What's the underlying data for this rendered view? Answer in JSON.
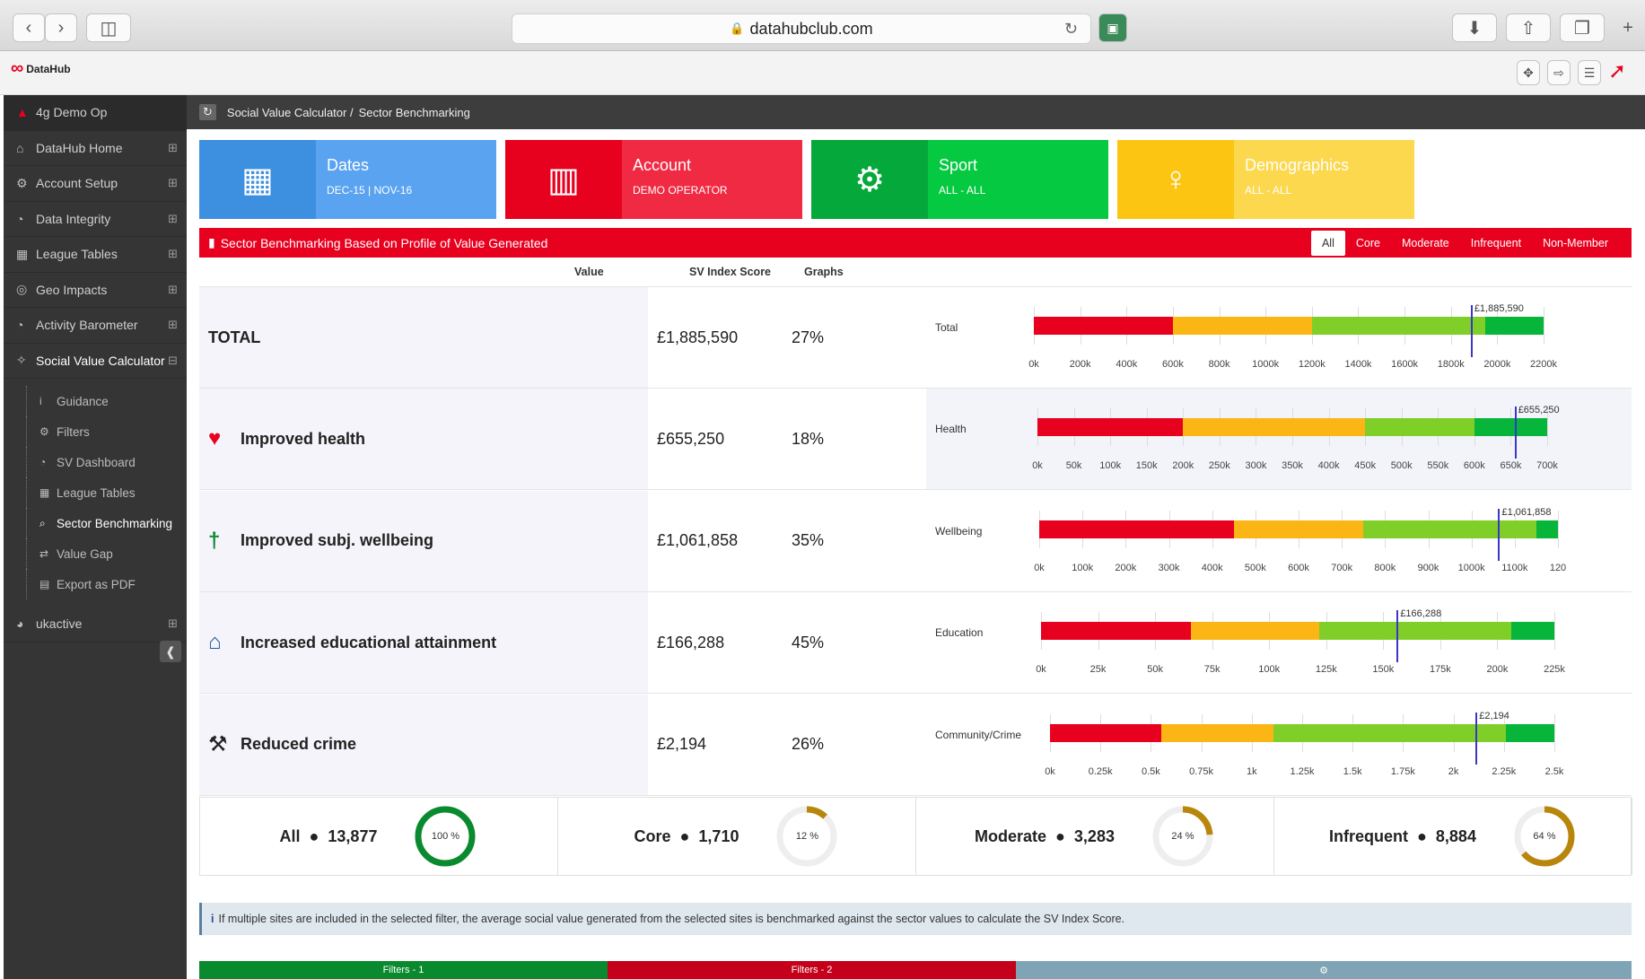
{
  "browser": {
    "url": "datahubclub.com"
  },
  "app": {
    "logo": "DataHub"
  },
  "sidebar": {
    "org": "4g Demo Op",
    "items": [
      {
        "label": "DataHub Home",
        "icon": "home-icon"
      },
      {
        "label": "Account Setup",
        "icon": "cogs-icon"
      },
      {
        "label": "Data Integrity",
        "icon": "dashboard-icon"
      },
      {
        "label": "League Tables",
        "icon": "table-icon"
      },
      {
        "label": "Geo Impacts",
        "icon": "globe-icon"
      },
      {
        "label": "Activity Barometer",
        "icon": "dashboard-icon"
      },
      {
        "label": "Social Value Calculator",
        "icon": "wand-icon"
      }
    ],
    "sub": [
      {
        "label": "Guidance",
        "icon": "info-icon"
      },
      {
        "label": "Filters",
        "icon": "cogs-icon"
      },
      {
        "label": "SV Dashboard",
        "icon": "dashboard-icon"
      },
      {
        "label": "League Tables",
        "icon": "table-icon"
      },
      {
        "label": "Sector Benchmarking",
        "icon": "search-icon"
      },
      {
        "label": "Value Gap",
        "icon": "exchange-icon"
      },
      {
        "label": "Export as PDF",
        "icon": "pdf-icon"
      }
    ],
    "extra": "ukactive"
  },
  "breadcrumb": {
    "a": "Social Value Calculator /",
    "b": "Sector Benchmarking"
  },
  "tiles": [
    {
      "title": "Dates",
      "sub": "DEC-15 | NOV-16",
      "color": "#3d8fe0",
      "light": "#5aa3f0"
    },
    {
      "title": "Account",
      "sub": "DEMO OPERATOR",
      "color": "#e8001f",
      "light": "#f02a43"
    },
    {
      "title": "Sport",
      "sub": "ALL - ALL",
      "color": "#05a83a",
      "light": "#05c940"
    },
    {
      "title": "Demographics",
      "sub": "ALL - ALL",
      "color": "#fbc512",
      "light": "#fbd84d"
    }
  ],
  "panel": {
    "title": "Sector Benchmarking Based on Profile of Value Generated",
    "tabs": [
      "All",
      "Core",
      "Moderate",
      "Infrequent",
      "Non-Member"
    ]
  },
  "table": {
    "headers": {
      "value": "Value",
      "score": "SV Index Score",
      "graphs": "Graphs"
    },
    "rows": [
      {
        "label": "TOTAL",
        "value": "£1,885,590",
        "score": "27%",
        "graph": "Total",
        "marker": "£1,885,590",
        "mval": 1885590,
        "max": 2200000,
        "ticks": [
          "0k",
          "200k",
          "400k",
          "600k",
          "800k",
          "1000k",
          "1200k",
          "1400k",
          "1600k",
          "1800k",
          "2000k",
          "2200k"
        ],
        "bands": [
          600000,
          1200000,
          1950000,
          2200000
        ]
      },
      {
        "label": "Improved health",
        "value": "£655,250",
        "score": "18%",
        "graph": "Health",
        "marker": "£655,250",
        "mval": 655250,
        "max": 700000,
        "ticks": [
          "0k",
          "50k",
          "100k",
          "150k",
          "200k",
          "250k",
          "300k",
          "350k",
          "400k",
          "450k",
          "500k",
          "550k",
          "600k",
          "650k",
          "700k"
        ],
        "bands": [
          200000,
          450000,
          600000,
          700000
        ]
      },
      {
        "label": "Improved subj. wellbeing",
        "value": "£1,061,858",
        "score": "35%",
        "graph": "Wellbeing",
        "marker": "£1,061,858",
        "mval": 1061858,
        "max": 1200000,
        "ticks": [
          "0k",
          "100k",
          "200k",
          "300k",
          "400k",
          "500k",
          "600k",
          "700k",
          "800k",
          "900k",
          "1000k",
          "1100k",
          "120"
        ],
        "bands": [
          450000,
          750000,
          1150000,
          1200000
        ]
      },
      {
        "label": "Increased educational attainment",
        "value": "£166,288",
        "score": "45%",
        "graph": "Education",
        "marker": "£166,288",
        "mval": 166288,
        "max": 240000,
        "ticks": [
          "0k",
          "25k",
          "50k",
          "75k",
          "100k",
          "125k",
          "150k",
          "175k",
          "200k",
          "225k"
        ],
        "bands": [
          70000,
          130000,
          220000,
          240000
        ]
      },
      {
        "label": "Reduced crime",
        "value": "£2,194",
        "score": "26%",
        "graph": "Community/Crime",
        "marker": "£2,194",
        "mval": 2194,
        "max": 2600,
        "ticks": [
          "0k",
          "0.25k",
          "0.5k",
          "0.75k",
          "1k",
          "1.25k",
          "1.5k",
          "1.75k",
          "2k",
          "2.25k",
          "2.5k"
        ],
        "bands": [
          575,
          1150,
          2350,
          2600
        ]
      }
    ]
  },
  "stats": [
    {
      "label": "All",
      "count": "13,877",
      "pct": "100 %",
      "p": 100,
      "color": "#0a8a2e"
    },
    {
      "label": "Core",
      "count": "1,710",
      "pct": "12 %",
      "p": 12,
      "color": "#b8860b"
    },
    {
      "label": "Moderate",
      "count": "3,283",
      "pct": "24 %",
      "p": 24,
      "color": "#b8860b"
    },
    {
      "label": "Infrequent",
      "count": "8,884",
      "pct": "64 %",
      "p": 64,
      "color": "#b8860b"
    }
  ],
  "info": "If multiple sites are included in the selected filter, the average social value generated from the selected sites is benchmarked against the sector values to calculate the SV Index Score.",
  "footer": [
    "Filters - 1",
    "Filters - 2"
  ]
}
